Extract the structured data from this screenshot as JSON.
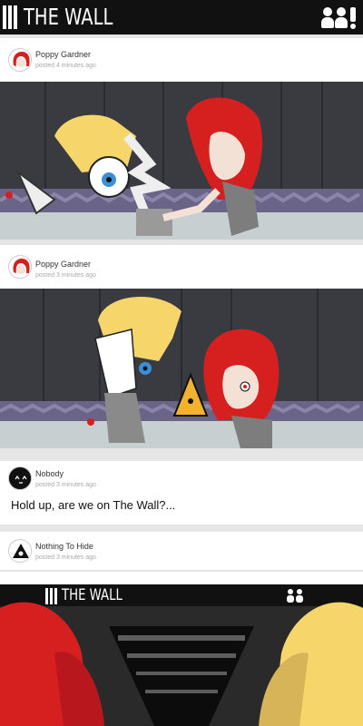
{
  "app": {
    "title": "THE WALL"
  },
  "header_icons": [
    "user-icon",
    "user-icon",
    "notification-icon"
  ],
  "posts": [
    {
      "author": "Poppy Gardner",
      "posted": "posted 4 minutes ago",
      "avatar": "red-hair-avatar",
      "text": ""
    },
    {
      "author": "Poppy Gardner",
      "posted": "posted 3 minutes ago",
      "avatar": "red-hair-avatar",
      "text": ""
    },
    {
      "author": "Nobody",
      "posted": "posted 3 minutes ago",
      "avatar": "nobody-face-avatar",
      "text": "Hold up, are we on The Wall?..."
    },
    {
      "author": "Nothing To Hide",
      "posted": "posted 3 minutes ago",
      "avatar": "eye-avatar",
      "text": ""
    }
  ],
  "inner_app": {
    "title": "THE WALL"
  },
  "colors": {
    "topbar": "#111111",
    "background": "#e6e6e6",
    "red_hair": "#d61f1f",
    "blond_hair": "#f6d56b",
    "panel_wall": "#3a3b40"
  }
}
